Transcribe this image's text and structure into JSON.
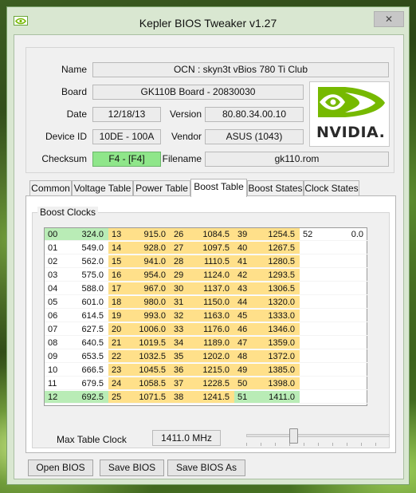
{
  "window": {
    "title": "Kepler BIOS Tweaker v1.27",
    "close_glyph": "✕"
  },
  "info": {
    "name_label": "Name",
    "name_value": "OCN : skyn3t vBios 780 Ti Club",
    "board_label": "Board",
    "board_value": "GK110B Board - 20830030",
    "date_label": "Date",
    "date_value": "12/18/13",
    "version_label": "Version",
    "version_value": "80.80.34.00.10",
    "device_label": "Device ID",
    "device_value": "10DE - 100A",
    "vendor_label": "Vendor",
    "vendor_value": "ASUS (1043)",
    "checksum_label": "Checksum",
    "checksum_value": "F4 - [F4]",
    "filename_label": "Filename",
    "filename_value": "gk110.rom",
    "logo_text": "NVIDIA."
  },
  "tabs": [
    {
      "label": "Common"
    },
    {
      "label": "Voltage Table"
    },
    {
      "label": "Power Table"
    },
    {
      "label": "Boost Table"
    },
    {
      "label": "Boost States"
    },
    {
      "label": "Clock States"
    }
  ],
  "boost": {
    "group_title": "Boost Clocks",
    "rows": [
      [
        "00",
        "324.0",
        "13",
        "915.0",
        "26",
        "1084.5",
        "39",
        "1254.5",
        "52",
        "0.0"
      ],
      [
        "01",
        "549.0",
        "14",
        "928.0",
        "27",
        "1097.5",
        "40",
        "1267.5",
        "",
        ""
      ],
      [
        "02",
        "562.0",
        "15",
        "941.0",
        "28",
        "1110.5",
        "41",
        "1280.5",
        "",
        ""
      ],
      [
        "03",
        "575.0",
        "16",
        "954.0",
        "29",
        "1124.0",
        "42",
        "1293.5",
        "",
        ""
      ],
      [
        "04",
        "588.0",
        "17",
        "967.0",
        "30",
        "1137.0",
        "43",
        "1306.5",
        "",
        ""
      ],
      [
        "05",
        "601.0",
        "18",
        "980.0",
        "31",
        "1150.0",
        "44",
        "1320.0",
        "",
        ""
      ],
      [
        "06",
        "614.5",
        "19",
        "993.0",
        "32",
        "1163.0",
        "45",
        "1333.0",
        "",
        ""
      ],
      [
        "07",
        "627.5",
        "20",
        "1006.0",
        "33",
        "1176.0",
        "46",
        "1346.0",
        "",
        ""
      ],
      [
        "08",
        "640.5",
        "21",
        "1019.5",
        "34",
        "1189.0",
        "47",
        "1359.0",
        "",
        ""
      ],
      [
        "09",
        "653.5",
        "22",
        "1032.5",
        "35",
        "1202.0",
        "48",
        "1372.0",
        "",
        ""
      ],
      [
        "10",
        "666.5",
        "23",
        "1045.5",
        "36",
        "1215.0",
        "49",
        "1385.0",
        "",
        ""
      ],
      [
        "11",
        "679.5",
        "24",
        "1058.5",
        "37",
        "1228.5",
        "50",
        "1398.0",
        "",
        ""
      ],
      [
        "12",
        "692.5",
        "25",
        "1071.5",
        "38",
        "1241.5",
        "51",
        "1411.0",
        "",
        ""
      ]
    ],
    "max_label": "Max Table Clock",
    "max_value": "1411.0 MHz"
  },
  "buttons": {
    "open": "Open BIOS",
    "save": "Save BIOS",
    "save_as": "Save BIOS As"
  },
  "colors": {
    "highlight_yellow": "#ffe08a",
    "highlight_green": "#b9ecb6",
    "accent_green": "#76b900"
  }
}
